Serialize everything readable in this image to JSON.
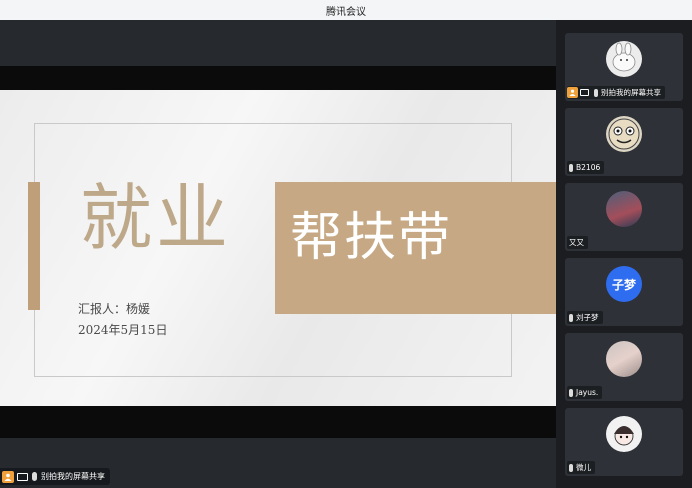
{
  "window": {
    "title": "腾讯会议"
  },
  "slide": {
    "main_title": "就业",
    "sub_title": "帮扶带",
    "reporter": "汇报人：杨媛",
    "date": "2024年5月15日"
  },
  "sharer": {
    "name": "别拍我的屏幕共享"
  },
  "participants": [
    {
      "name": "别拍我的屏幕共享",
      "is_host": true,
      "is_sharing": true,
      "avatar": "rabbit-sketch"
    },
    {
      "name": "B2106",
      "is_host": false,
      "is_sharing": false,
      "avatar": "cartoon-face"
    },
    {
      "name": "又又",
      "is_host": false,
      "is_sharing": false,
      "avatar": "photo"
    },
    {
      "name": "刘子梦",
      "is_host": false,
      "is_sharing": false,
      "avatar": "text",
      "avatar_text": "子梦"
    },
    {
      "name": "Jayus.",
      "is_host": false,
      "is_sharing": false,
      "avatar": "photo"
    },
    {
      "name": "微儿",
      "is_host": false,
      "is_sharing": false,
      "avatar": "cartoon-girl"
    }
  ],
  "colors": {
    "accent_tan": "#c6a984",
    "title_tan": "#bea88a",
    "host_orange": "#f0a13c",
    "avatar_blue": "#2f6df0"
  }
}
